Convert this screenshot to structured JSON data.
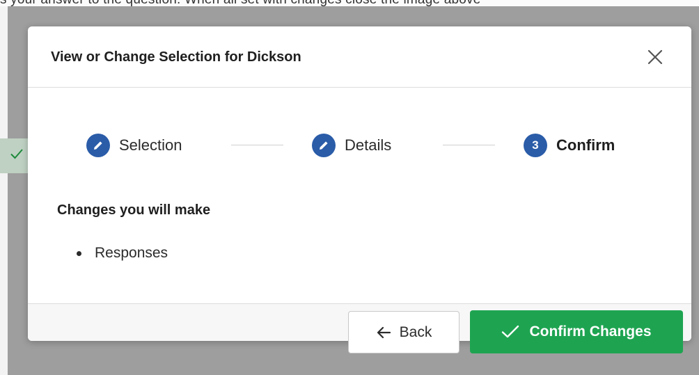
{
  "background": {
    "partial_text": "s your answer to the question. When all set with changes close the image above"
  },
  "modal": {
    "title": "View or Change Selection for Dickson",
    "close_icon": "close-icon",
    "steps": [
      {
        "number": "",
        "label": "Selection",
        "icon": "pencil-icon",
        "state": "completed"
      },
      {
        "number": "",
        "label": "Details",
        "icon": "pencil-icon",
        "state": "completed"
      },
      {
        "number": "3",
        "label": "Confirm",
        "icon": "",
        "state": "active"
      }
    ],
    "changes_heading": "Changes you will make",
    "changes": [
      "Responses"
    ]
  },
  "footer": {
    "back_label": "Back",
    "back_icon": "arrow-left-icon",
    "confirm_label": "Confirm Changes",
    "confirm_icon": "checkmark-icon"
  },
  "colors": {
    "accent_blue": "#2a5ca8",
    "confirm_green": "#1ea451",
    "overlay": "#9e9e9e"
  }
}
